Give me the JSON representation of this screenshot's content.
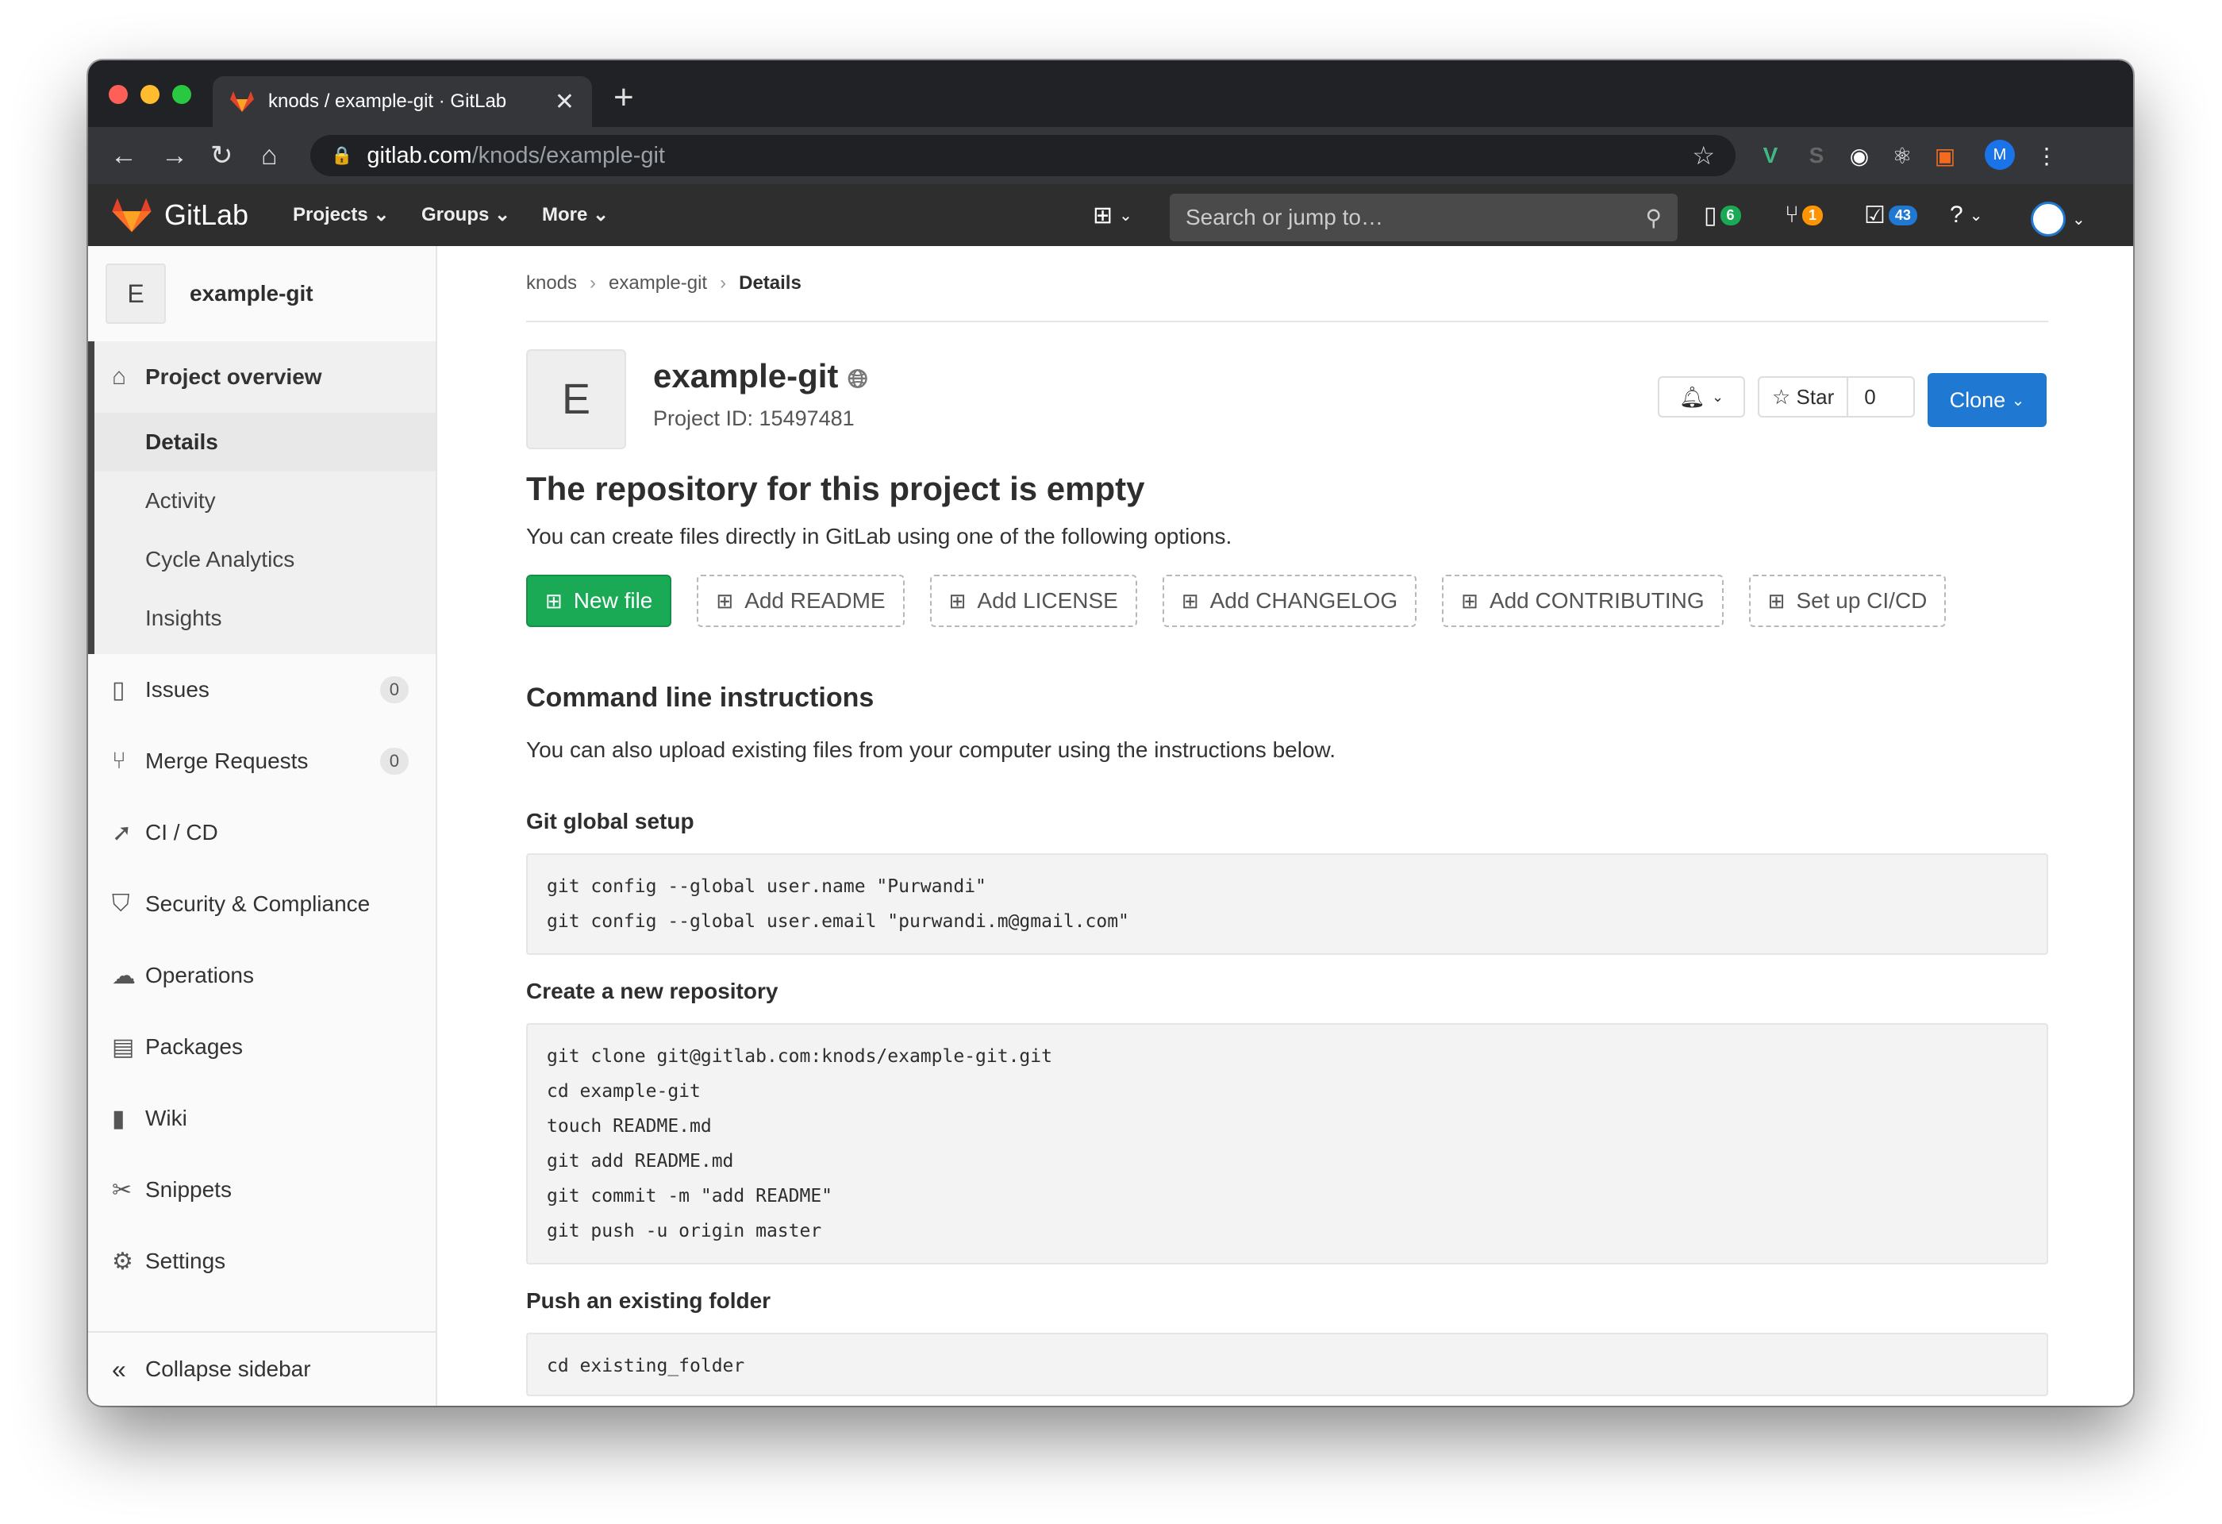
{
  "browser": {
    "tab_title": "knods / example-git · GitLab",
    "url_host": "gitlab.com",
    "url_path": "/knods/example-git",
    "profile_initial": "M"
  },
  "navbar": {
    "brand": "GitLab",
    "projects": "Projects",
    "groups": "Groups",
    "more": "More",
    "search_placeholder": "Search or jump to…",
    "issues_count": "6",
    "mr_count": "1",
    "todo_count": "43"
  },
  "sidebar": {
    "project_avatar": "E",
    "project_name": "example-git",
    "overview": "Project overview",
    "overview_items": [
      "Details",
      "Activity",
      "Cycle Analytics",
      "Insights"
    ],
    "items": [
      {
        "label": "Issues",
        "count": "0"
      },
      {
        "label": "Merge Requests",
        "count": "0"
      },
      {
        "label": "CI / CD"
      },
      {
        "label": "Security & Compliance"
      },
      {
        "label": "Operations"
      },
      {
        "label": "Packages"
      },
      {
        "label": "Wiki"
      },
      {
        "label": "Snippets"
      },
      {
        "label": "Settings"
      }
    ],
    "collapse": "Collapse sidebar"
  },
  "breadcrumb": [
    "knods",
    "example-git",
    "Details"
  ],
  "project": {
    "avatar": "E",
    "name": "example-git",
    "id_text": "Project ID: 15497481",
    "star_label": "Star",
    "star_count": "0",
    "clone_label": "Clone"
  },
  "empty": {
    "title": "The repository for this project is empty",
    "text": "You can create files directly in GitLab using one of the following options.",
    "actions": [
      "New file",
      "Add README",
      "Add LICENSE",
      "Add CHANGELOG",
      "Add CONTRIBUTING",
      "Set up CI/CD"
    ]
  },
  "cli": {
    "title": "Command line instructions",
    "text": "You can also upload existing files from your computer using the instructions below.",
    "global_title": "Git global setup",
    "global_code": [
      "git config --global user.name \"Purwandi\"",
      "git config --global user.email \"purwandi.m@gmail.com\""
    ],
    "new_title": "Create a new repository",
    "new_code": [
      "git clone git@gitlab.com:knods/example-git.git",
      "cd example-git",
      "touch README.md",
      "git add README.md",
      "git commit -m \"add README\"",
      "git push -u origin master"
    ],
    "push_title": "Push an existing folder",
    "push_code": [
      "cd existing_folder"
    ]
  },
  "colors": {
    "accent": "#1f78d1",
    "success": "#1aaa55",
    "navbar": "#2e2e2e"
  }
}
